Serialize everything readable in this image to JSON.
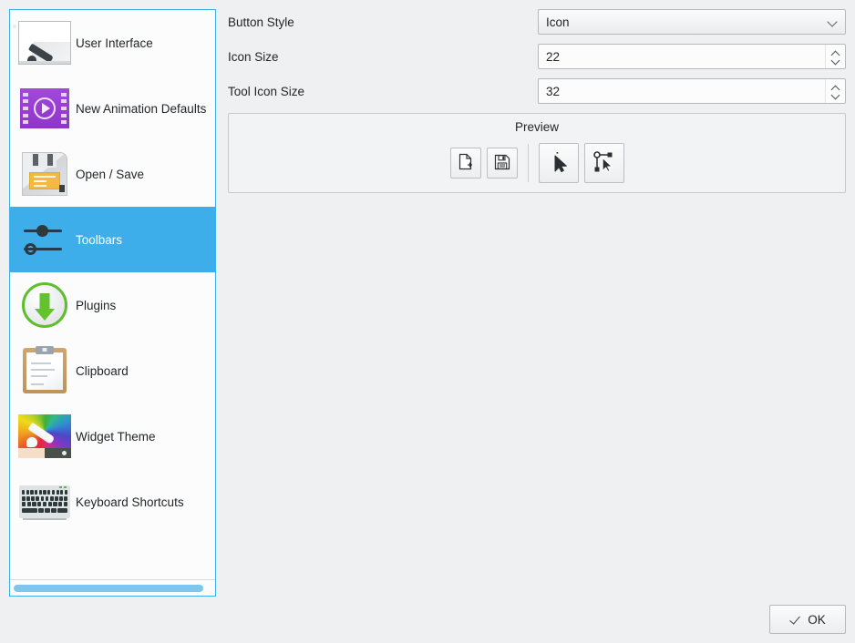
{
  "sidebar": {
    "items": [
      {
        "label": "User Interface",
        "icon": "user-interface-icon",
        "selected": false
      },
      {
        "label": "New Animation Defaults",
        "icon": "animation-film-icon",
        "selected": false
      },
      {
        "label": "Open / Save",
        "icon": "floppy-disk-icon",
        "selected": false
      },
      {
        "label": "Toolbars",
        "icon": "sliders-icon",
        "selected": true
      },
      {
        "label": "Plugins",
        "icon": "download-circle-icon",
        "selected": false
      },
      {
        "label": "Clipboard",
        "icon": "clipboard-icon",
        "selected": false
      },
      {
        "label": "Widget Theme",
        "icon": "color-wheel-brush-icon",
        "selected": false
      },
      {
        "label": "Keyboard Shortcuts",
        "icon": "keyboard-icon",
        "selected": false
      }
    ],
    "scrollbar": {
      "orientation": "horizontal",
      "thumb_color": "#7fc6ee"
    }
  },
  "settings": {
    "button_style": {
      "label": "Button Style",
      "value": "Icon",
      "control": "combobox"
    },
    "icon_size": {
      "label": "Icon Size",
      "value": "22",
      "control": "spinbox"
    },
    "tool_icon_size": {
      "label": "Tool Icon Size",
      "value": "32",
      "control": "spinbox"
    }
  },
  "preview": {
    "title": "Preview",
    "buttons": [
      {
        "icon": "new-document-icon",
        "size": "small"
      },
      {
        "icon": "save-floppy-icon",
        "size": "small"
      },
      {
        "icon": "select-arrow-tool-icon",
        "size": "large"
      },
      {
        "icon": "edit-path-node-tool-icon",
        "size": "large"
      }
    ]
  },
  "dialog": {
    "ok_label": "OK",
    "ok_icon": "check-icon"
  },
  "colors": {
    "highlight": "#3daee9",
    "window_bg": "#eff0f1",
    "view_bg": "#fcfcfc",
    "text": "#232629"
  }
}
